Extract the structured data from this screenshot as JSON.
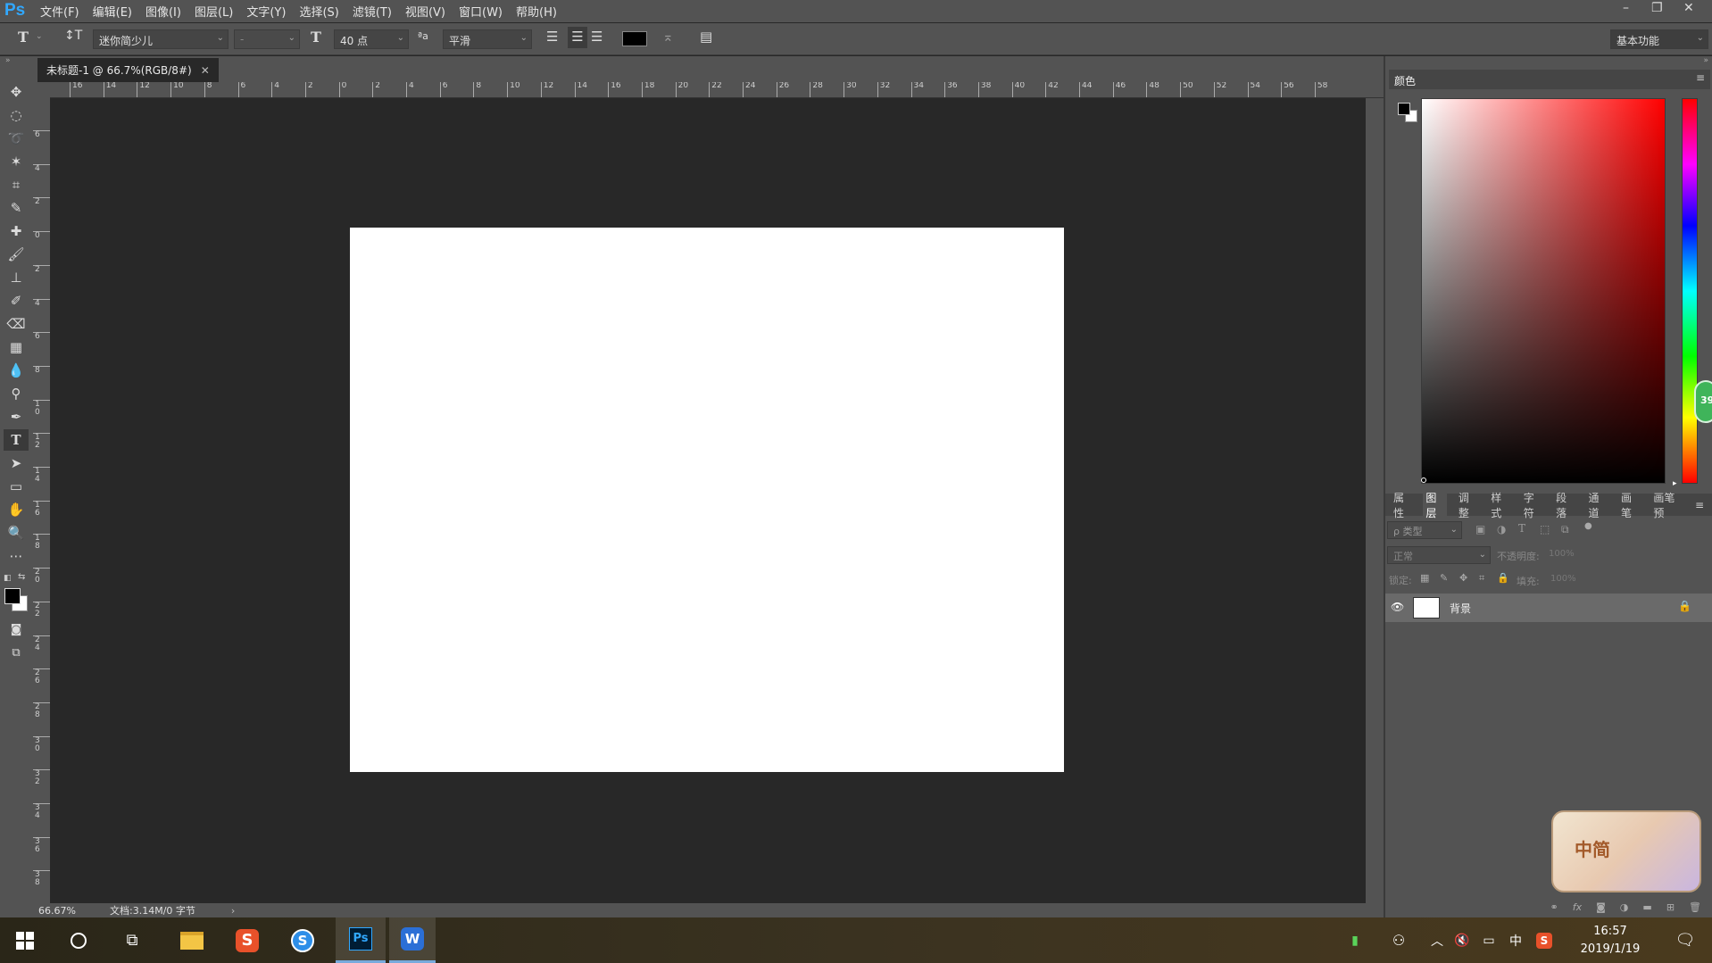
{
  "app": {
    "logo": "Ps"
  },
  "menu": [
    "文件(F)",
    "编辑(E)",
    "图像(I)",
    "图层(L)",
    "文字(Y)",
    "选择(S)",
    "滤镜(T)",
    "视图(V)",
    "窗口(W)",
    "帮助(H)"
  ],
  "window_controls": {
    "minimize": "–",
    "restore": "❐",
    "close": "✕"
  },
  "options": {
    "font_family": "迷你简少儿",
    "font_style": "-",
    "font_size": "40 点",
    "aa_label": "ªa",
    "antialias": "平滑",
    "text_color": "#000000",
    "workspace": "基本功能"
  },
  "document": {
    "tab_title": "未标题-1 @ 66.7%(RGB/8#)",
    "zoom": "66.67%",
    "doc_info": "文档:3.14M/0 字节"
  },
  "rulers": {
    "h_labels": [
      "16",
      "14",
      "12",
      "10",
      "8",
      "6",
      "4",
      "2",
      "0",
      "2",
      "4",
      "6",
      "8",
      "10",
      "12",
      "14",
      "16",
      "18",
      "20",
      "22",
      "24",
      "26",
      "28",
      "30",
      "32",
      "34",
      "36",
      "38",
      "40",
      "42",
      "44",
      "46",
      "48",
      "50",
      "52",
      "54",
      "56",
      "58"
    ],
    "v_labels": [
      "6",
      "4",
      "2",
      "0",
      "2",
      "4",
      "6",
      "8",
      "10",
      "12",
      "14",
      "16",
      "18",
      "20",
      "22",
      "24",
      "26",
      "28",
      "30",
      "32",
      "34",
      "36",
      "38"
    ]
  },
  "color_panel": {
    "title": "颜色",
    "foreground": "#000000",
    "background": "#ffffff",
    "hue_badge": "39"
  },
  "layer_tabs": [
    "属性",
    "图层",
    "调整",
    "样式",
    "字符",
    "段落",
    "通道",
    "画笔",
    "画笔预"
  ],
  "layers_panel": {
    "filter_placeholder": "ρ 类型",
    "blend_mode": "正常",
    "opacity_label": "不透明度:",
    "opacity_value": "100%",
    "lock_label": "锁定:",
    "fill_label": "填充:",
    "fill_value": "100%",
    "layers": [
      {
        "name": "背景",
        "visible": true,
        "locked": true
      }
    ]
  },
  "sticker": {
    "text": "中简"
  },
  "taskbar": {
    "time": "16:57",
    "date": "2019/1/19",
    "ime": "中",
    "apps": [
      "windows-start",
      "cortana",
      "task-view",
      "file-explorer",
      "sogou-input",
      "sogou-browser",
      "photoshop",
      "wps-writer"
    ]
  }
}
